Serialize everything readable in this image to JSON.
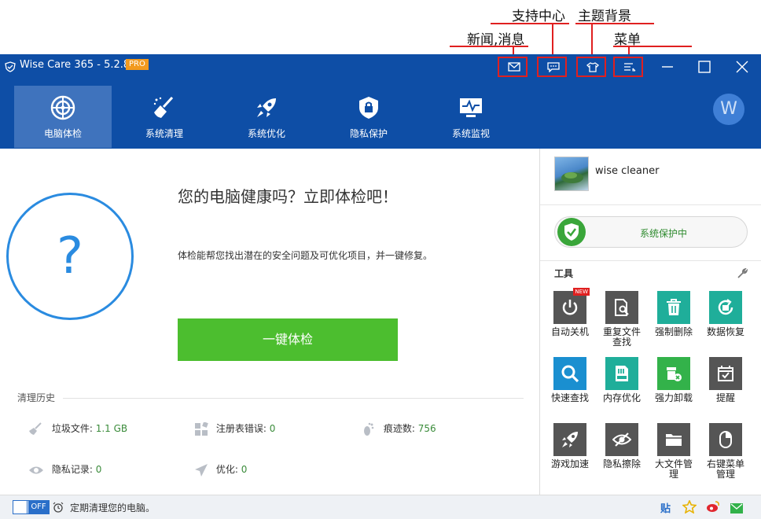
{
  "annotations": {
    "news": "新闻,消息",
    "support": "支持中心",
    "theme": "主题背景",
    "menu": "菜单"
  },
  "app": {
    "title": "Wise Care 365 - 5.2.8",
    "badge": "PRO",
    "avatar_letter": "W"
  },
  "nav": [
    {
      "label": "电脑体检"
    },
    {
      "label": "系统清理"
    },
    {
      "label": "系统优化"
    },
    {
      "label": "隐私保护"
    },
    {
      "label": "系统监视"
    }
  ],
  "main": {
    "headline": "您的电脑健康吗？立即体检吧！",
    "description": "体检能帮您找出潜在的安全问题及可优化项目，并一键修复。",
    "question_mark": "?",
    "scan_button": "一键体检",
    "history_title": "清理历史",
    "history": {
      "junk_label": "垃圾文件:",
      "junk_value": "1.1 GB",
      "registry_label": "注册表错误:",
      "registry_value": "0",
      "traces_label": "痕迹数:",
      "traces_value": "756",
      "privacy_label": "隐私记录:",
      "privacy_value": "0",
      "optimize_label": "优化:",
      "optimize_value": "0"
    }
  },
  "side": {
    "username": "wise cleaner",
    "protection_label": "系统保护中",
    "tools_title": "工具",
    "new_badge": "NEW",
    "tools": [
      {
        "label": "自动关机",
        "icon": "power-icon",
        "color": "#555555"
      },
      {
        "label": "重复文件\n查找",
        "icon": "duplicate-file-icon",
        "color": "#555555"
      },
      {
        "label": "强制删除",
        "icon": "trash-icon",
        "color": "#1fae9a"
      },
      {
        "label": "数据恢复",
        "icon": "recover-icon",
        "color": "#1fae9a"
      },
      {
        "label": "快速查找",
        "icon": "search-icon",
        "color": "#1a8fd0"
      },
      {
        "label": "内存优化",
        "icon": "memory-icon",
        "color": "#1fae9a"
      },
      {
        "label": "强力卸载",
        "icon": "uninstall-icon",
        "color": "#33b24a"
      },
      {
        "label": "提醒",
        "icon": "calendar-icon",
        "color": "#555555"
      },
      {
        "label": "游戏加速",
        "icon": "rocket-icon",
        "color": "#555555"
      },
      {
        "label": "隐私擦除",
        "icon": "eye-off-icon",
        "color": "#555555"
      },
      {
        "label": "大文件管\n理",
        "icon": "folder-icon",
        "color": "#555555"
      },
      {
        "label": "右键菜单\n管理",
        "icon": "mouse-icon",
        "color": "#555555"
      }
    ]
  },
  "footer": {
    "toggle_state": "OFF",
    "schedule_text": "定期清理您的电脑。",
    "tie_label": "贴"
  }
}
